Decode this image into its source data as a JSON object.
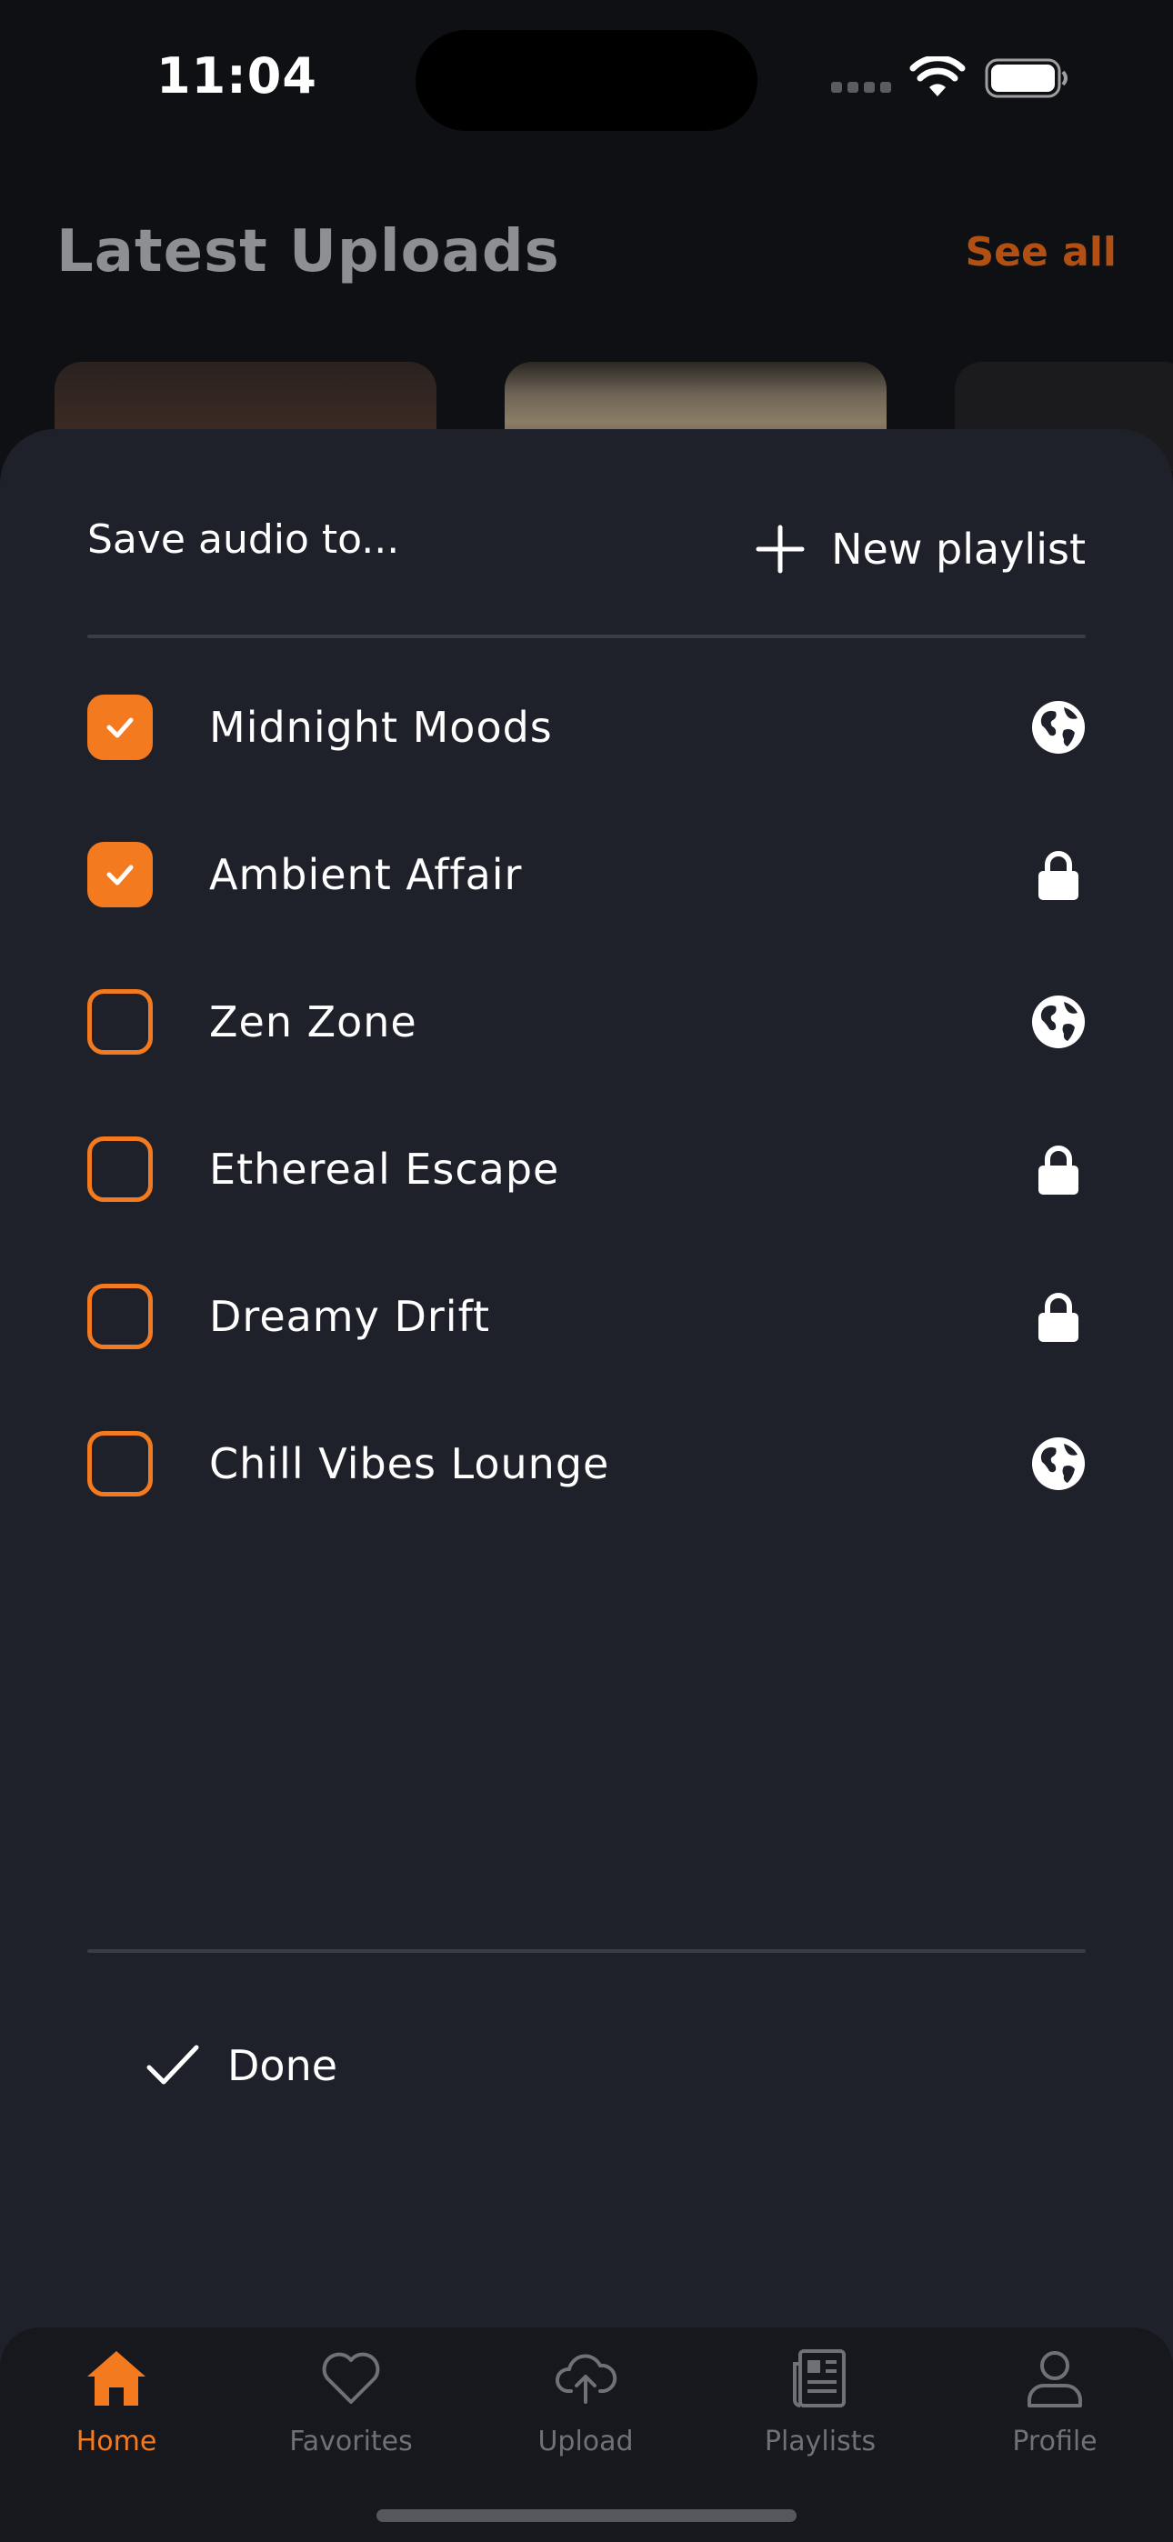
{
  "status_bar": {
    "time": "11:04"
  },
  "background": {
    "section_title": "Latest Uploads",
    "see_all": "See all"
  },
  "sheet": {
    "title": "Save audio to...",
    "new_playlist_label": "New playlist",
    "playlists": [
      {
        "name": "Midnight Moods",
        "checked": true,
        "visibility": "globe-icon"
      },
      {
        "name": "Ambient Affair",
        "checked": true,
        "visibility": "lock-icon"
      },
      {
        "name": "Zen Zone",
        "checked": false,
        "visibility": "globe-icon"
      },
      {
        "name": "Ethereal Escape",
        "checked": false,
        "visibility": "lock-icon"
      },
      {
        "name": "Dreamy Drift",
        "checked": false,
        "visibility": "lock-icon"
      },
      {
        "name": "Chill Vibes Lounge",
        "checked": false,
        "visibility": "globe-icon"
      }
    ],
    "done_label": "Done"
  },
  "tab_bar": {
    "items": [
      {
        "label": "Home",
        "icon": "home-icon",
        "active": true
      },
      {
        "label": "Favorites",
        "icon": "heart-icon",
        "active": false
      },
      {
        "label": "Upload",
        "icon": "cloud-upload-icon",
        "active": false
      },
      {
        "label": "Playlists",
        "icon": "newspaper-icon",
        "active": false
      },
      {
        "label": "Profile",
        "icon": "user-icon",
        "active": false
      }
    ]
  },
  "colors": {
    "accent": "#f47a20",
    "sheet_background": "#1f212a",
    "page_background": "#0f1014",
    "inactive_tab": "#6f7178"
  }
}
